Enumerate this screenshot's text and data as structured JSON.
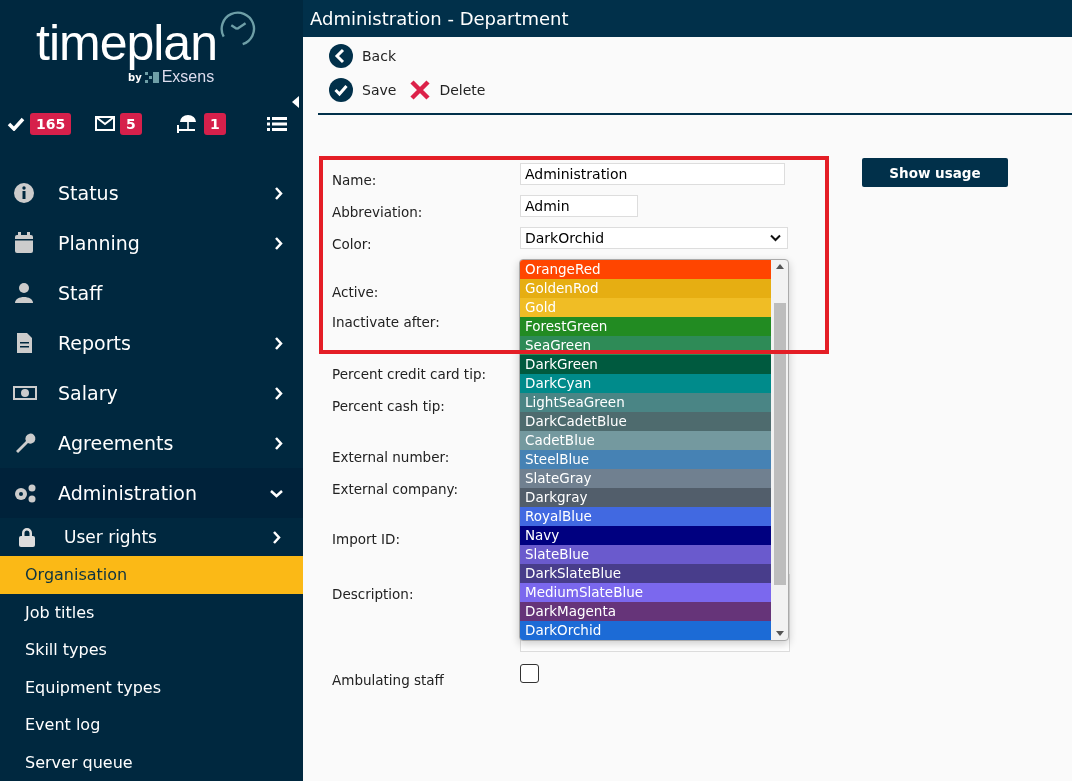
{
  "logo": {
    "name": "timeplan",
    "by": "by",
    "company": "Exsens"
  },
  "counters": [
    {
      "kind": "tasks",
      "count": "165"
    },
    {
      "kind": "messages",
      "count": "5"
    },
    {
      "kind": "vacation",
      "count": "1"
    }
  ],
  "nav": [
    {
      "label": "Status",
      "kind": "submenu"
    },
    {
      "label": "Planning",
      "kind": "submenu"
    },
    {
      "label": "Staff",
      "kind": "link"
    },
    {
      "label": "Reports",
      "kind": "submenu"
    },
    {
      "label": "Salary",
      "kind": "submenu"
    },
    {
      "label": "Agreements",
      "kind": "submenu"
    },
    {
      "label": "Administration",
      "kind": "open"
    }
  ],
  "subnav": {
    "group": {
      "label": "User rights"
    },
    "items": [
      {
        "label": "Organisation",
        "selected": true
      },
      {
        "label": "Job titles",
        "selected": false
      },
      {
        "label": "Skill types",
        "selected": false
      },
      {
        "label": "Equipment types",
        "selected": false
      },
      {
        "label": "Event log",
        "selected": false
      },
      {
        "label": "Server queue",
        "selected": false
      }
    ]
  },
  "window": {
    "title": "Administration - Department"
  },
  "toolbar": {
    "back": "Back",
    "save": "Save",
    "delete": "Delete"
  },
  "form": {
    "fields": [
      {
        "label": "Name:",
        "kind": "text",
        "value": "Administration"
      },
      {
        "label": "Abbreviation:",
        "kind": "short",
        "value": "Admin"
      },
      {
        "label": "Color:",
        "kind": "select",
        "value": "DarkOrchid"
      },
      {
        "label": "Active:",
        "kind": "hidden"
      },
      {
        "label": "Inactivate after:",
        "kind": "hidden"
      },
      {
        "label": "Percent credit card tip:",
        "kind": "hidden"
      },
      {
        "label": "Percent cash tip:",
        "kind": "hidden"
      },
      {
        "label": "External number:",
        "kind": "hidden"
      },
      {
        "label": "External company:",
        "kind": "hidden"
      },
      {
        "label": "Import ID:",
        "kind": "hidden"
      },
      {
        "label": "Description:",
        "kind": "textarea"
      },
      {
        "label": "Ambulating staff",
        "kind": "checkbox",
        "checked": false
      }
    ],
    "show_usage": "Show usage"
  },
  "color_options": [
    {
      "label": "OrangeRed",
      "color": "#ff4500",
      "selected": false
    },
    {
      "label": "GoldenRod",
      "color": "#e6ae12",
      "selected": false
    },
    {
      "label": "Gold",
      "color": "#f0bd25",
      "selected": false
    },
    {
      "label": "ForestGreen",
      "color": "#228b22",
      "selected": false
    },
    {
      "label": "SeaGreen",
      "color": "#2e8b57",
      "selected": false
    },
    {
      "label": "DarkGreen",
      "color": "#005a3f",
      "selected": false
    },
    {
      "label": "DarkCyan",
      "color": "#008b8b",
      "selected": false
    },
    {
      "label": "LightSeaGreen",
      "color": "#4a8585",
      "selected": false
    },
    {
      "label": "DarkCadetBlue",
      "color": "#4e6b6e",
      "selected": false
    },
    {
      "label": "CadetBlue",
      "color": "#74999f",
      "selected": false
    },
    {
      "label": "SteelBlue",
      "color": "#4682b4",
      "selected": false
    },
    {
      "label": "SlateGray",
      "color": "#708090",
      "selected": false
    },
    {
      "label": "Darkgray",
      "color": "#525e6b",
      "selected": false
    },
    {
      "label": "RoyalBlue",
      "color": "#4169e1",
      "selected": false
    },
    {
      "label": "Navy",
      "color": "#000080",
      "selected": false
    },
    {
      "label": "SlateBlue",
      "color": "#6a5acd",
      "selected": false
    },
    {
      "label": "DarkSlateBlue",
      "color": "#483d8b",
      "selected": false
    },
    {
      "label": "MediumSlateBlue",
      "color": "#7b68ee",
      "selected": false
    },
    {
      "label": "DarkMagenta",
      "color": "#663479",
      "selected": false
    },
    {
      "label": "DarkOrchid",
      "selected": true
    }
  ]
}
